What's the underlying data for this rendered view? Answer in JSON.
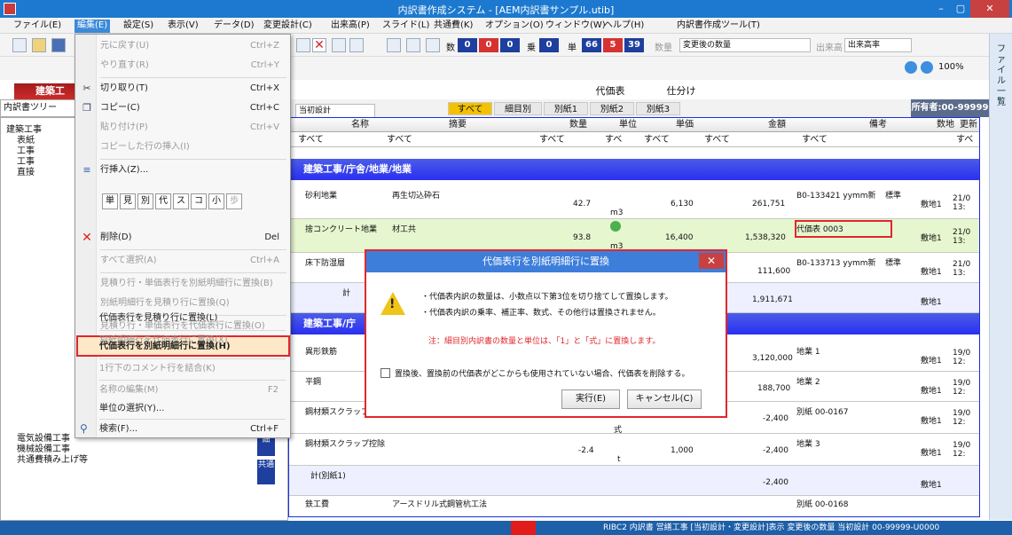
{
  "title": "内訳書作成システム - [AEM内訳書サンプル.utib]",
  "menubar": [
    "ファイル(E)",
    "編集(E)",
    "設定(S)",
    "表示(V)",
    "データ(D)",
    "変更設計(C)",
    "出来高(P)",
    "スライド(L)",
    "共通費(K)",
    "オプション(O)",
    "ウィンドウ(W)",
    "ヘルプ(H)",
    "内訳書作成ツール(T)"
  ],
  "toolbar": {
    "boxes": [
      {
        "label": "数",
        "values": [
          "0",
          "0",
          "0"
        ]
      },
      {
        "label": "乗",
        "values": [
          "0"
        ]
      },
      {
        "label": "単",
        "values": [
          "66",
          "5",
          "39"
        ]
      }
    ],
    "qty_label": "数量",
    "qty_select": "変更後の数量",
    "dekidaka_label": "出来高",
    "dekidaka_select": "出来高率",
    "zoom": "100%"
  },
  "rightstrip": "ファイル一覧",
  "tabs": {
    "main": "建築工",
    "daika": "代価表",
    "shiwake": "仕分け"
  },
  "tree": {
    "header": "内訳書ツリー",
    "nodes": [
      "建築工事",
      "表紙",
      "工事",
      "工事",
      "直接",
      "電気設備工事",
      "機械設備工事",
      "共通費積み上げ等"
    ]
  },
  "filterbar": {
    "design": "当初設計",
    "buttons": [
      "すべて",
      "細目別",
      "別紙1",
      "別紙2",
      "別紙3"
    ],
    "owner": "所有者:00-99999"
  },
  "grid": {
    "headers": [
      "名称",
      "摘要",
      "数量",
      "単位",
      "単価",
      "金額",
      "備考",
      "数地",
      "更新"
    ],
    "filter": [
      "すべて",
      "すべて",
      "すべて",
      "すべ",
      "すべて",
      "すべて",
      "すべて",
      "すべ"
    ],
    "sections": [
      "建築工事/庁舎/地業/地業",
      "建築工事/庁"
    ],
    "rows": [
      {
        "name": "砂利地業",
        "spec": "再生切込砕石",
        "qty": "42.7",
        "unit": "m3",
        "price": "6,130",
        "amount": "261,751",
        "note": "B0-133421 yymm新",
        "std": "標準",
        "loc": "敷地1",
        "upd": "21/0 13:"
      },
      {
        "name": "捨コンクリート地業",
        "spec": "材工共",
        "qty": "93.8",
        "unit": "m3",
        "price": "16,400",
        "amount": "1,538,320",
        "note": "代価表 0003",
        "std": "",
        "loc": "敷地1",
        "upd": "21/0 13:"
      },
      {
        "name": "床下防湿層",
        "spec": "",
        "qty": "",
        "unit": "",
        "price": "",
        "amount": "111,600",
        "note": "B0-133713 yymm新",
        "std": "標準",
        "loc": "敷地1",
        "upd": "21/0 13:"
      },
      {
        "name": "計",
        "spec": "",
        "qty": "",
        "unit": "",
        "price": "",
        "amount": "1,911,671",
        "note": "",
        "std": "",
        "loc": "敷地1",
        "upd": ""
      },
      {
        "name": "異形鉄筋",
        "spec": "",
        "qty": "",
        "unit": "",
        "price": "",
        "amount": "3,120,000",
        "note": "地業 1",
        "std": "",
        "loc": "敷地1",
        "upd": "19/0 12:"
      },
      {
        "name": "平鋼",
        "spec": "",
        "qty": "",
        "unit": "",
        "price": "",
        "amount": "188,700",
        "note": "地業 2",
        "std": "",
        "loc": "敷地1",
        "upd": "19/0 12:"
      },
      {
        "name": "鋼材類スクラップ",
        "spec": "",
        "qty": "",
        "unit": "式",
        "price": "",
        "amount": "-2,400",
        "note": "別紙 00-0167",
        "std": "",
        "loc": "敷地1",
        "upd": "19/0 12:"
      },
      {
        "name": "鋼材類スクラップ控除",
        "spec": "",
        "qty": "-2.4",
        "unit": "t",
        "price": "1,000",
        "amount": "-2,400",
        "note": "地業 3",
        "std": "",
        "loc": "敷地1",
        "upd": "19/0 12:"
      },
      {
        "name": "計(別紙1)",
        "spec": "",
        "qty": "",
        "unit": "",
        "price": "",
        "amount": "-2,400",
        "note": "",
        "std": "",
        "loc": "敷地1",
        "upd": ""
      },
      {
        "name": "鉄工費",
        "spec": "アースドリル式鋼管杭工法",
        "qty": "",
        "unit": "",
        "price": "",
        "amount": "",
        "note": "別紙 00-0168",
        "std": "",
        "loc": "",
        "upd": ""
      }
    ],
    "side_tags": [
      "細",
      "共通"
    ]
  },
  "menu": {
    "items": [
      {
        "label": "元に戻す(U)",
        "sc": "Ctrl+Z",
        "dis": true
      },
      {
        "label": "やり直す(R)",
        "sc": "Ctrl+Y",
        "dis": true
      },
      {
        "label": "切り取り(T)",
        "sc": "Ctrl+X",
        "dis": false
      },
      {
        "label": "コピー(C)",
        "sc": "Ctrl+C",
        "dis": false
      },
      {
        "label": "貼り付け(P)",
        "sc": "Ctrl+V",
        "dis": true
      },
      {
        "label": "コピーした行の挿入(I)",
        "sc": "",
        "dis": true
      },
      {
        "label": "行挿入(Z)...",
        "sc": "",
        "dis": false
      },
      {
        "label": "削除(D)",
        "sc": "Del",
        "dis": false
      },
      {
        "label": "すべて選択(A)",
        "sc": "Ctrl+A",
        "dis": true
      },
      {
        "label": "見積り行・単価表行を別紙明細行に置換(B)",
        "sc": "",
        "dis": true
      },
      {
        "label": "別紙明細行を見積り行に置換(Q)",
        "sc": "",
        "dis": true
      },
      {
        "label": "見積り行・単価表行を代価表行に置換(O)",
        "sc": "",
        "dis": true
      },
      {
        "label": "代価表行を見積り行に置換(L)",
        "sc": "",
        "dis": false
      },
      {
        "label": "別紙明細行を代価表行に置換(X)",
        "sc": "",
        "dis": true
      },
      {
        "label": "代価表行を別紙明細行に置換(H)",
        "sc": "",
        "dis": false
      },
      {
        "label": "1行下のコメント行を結合(K)",
        "sc": "",
        "dis": true
      },
      {
        "label": "名称の編集(M)",
        "sc": "F2",
        "dis": true
      },
      {
        "label": "単位の選択(Y)...",
        "sc": "",
        "dis": false
      },
      {
        "label": "検索(F)...",
        "sc": "Ctrl+F",
        "dis": false
      }
    ],
    "rowbuttons": [
      "単",
      "見",
      "別",
      "代",
      "ス",
      "コ",
      "小",
      "歩"
    ]
  },
  "dialog": {
    "title": "代価表行を別紙明細行に置換",
    "line1": "・代価表内訳の数量は、小数点以下第3位を切り捨てして置換します。",
    "line2": "・代価表内訳の乗率、補正率、数式、その他行は置換されません。",
    "note": "注：細目別内訳書の数量と単位は、「1」と「式」に置換します。",
    "checkbox": "置換後、置換前の代価表がどこからも使用されていない場合、代価表を削除する。",
    "ok": "実行(E)",
    "cancel": "キャンセル(C)"
  },
  "status": "RIBC2 内訳書 営繕工事 [当初設計・変更設計]表示 変更後の数量 当初設計 00-99999-U0000"
}
